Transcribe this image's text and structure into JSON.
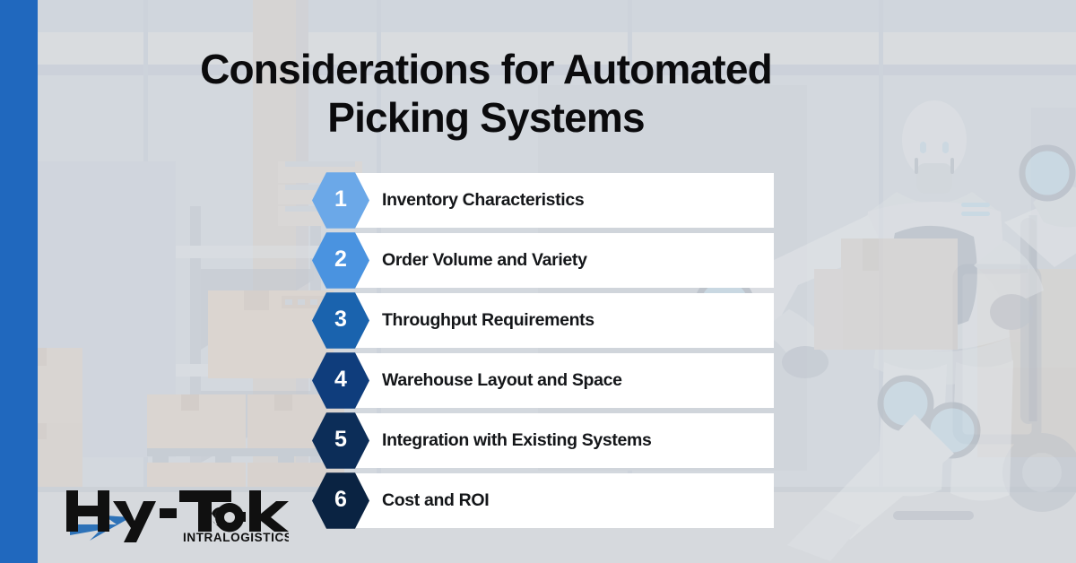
{
  "meta": {
    "brand_blue": "#2068be",
    "background": "#d3d8de",
    "card_bg": "#ffffff",
    "text_color": "#141619"
  },
  "header": {
    "title_line1": "Considerations for Automated",
    "title_line2": "Picking Systems",
    "title_full": "Considerations for Automated Picking Systems"
  },
  "list": {
    "items": [
      {
        "number": "1",
        "label": "Inventory Characteristics",
        "hex_color": "#6ba8e8"
      },
      {
        "number": "2",
        "label": "Order Volume and Variety",
        "hex_color": "#4a93e0"
      },
      {
        "number": "3",
        "label": "Throughput Requirements",
        "hex_color": "#1a63ae"
      },
      {
        "number": "4",
        "label": "Warehouse Layout and Space",
        "hex_color": "#0f3d7c"
      },
      {
        "number": "5",
        "label": "Integration with Existing Systems",
        "hex_color": "#0c2d58"
      },
      {
        "number": "6",
        "label": "Cost and ROI",
        "hex_color": "#0a2342"
      }
    ]
  },
  "logo": {
    "wordmark": "Hy-Tek",
    "tagline": "INTRALOGISTICS",
    "accent_color": "#2d72b8",
    "wordmark_color": "#101010"
  },
  "background_scene": {
    "description": "faded warehouse interior with pallet racking, stacked cardboard boxes and a humanoid picking robot carrying a box beside a hand truck",
    "elements": [
      "warehouse-racking",
      "cardboard-boxes",
      "pallets",
      "humanoid-robot",
      "hand-truck",
      "floor-band"
    ]
  }
}
